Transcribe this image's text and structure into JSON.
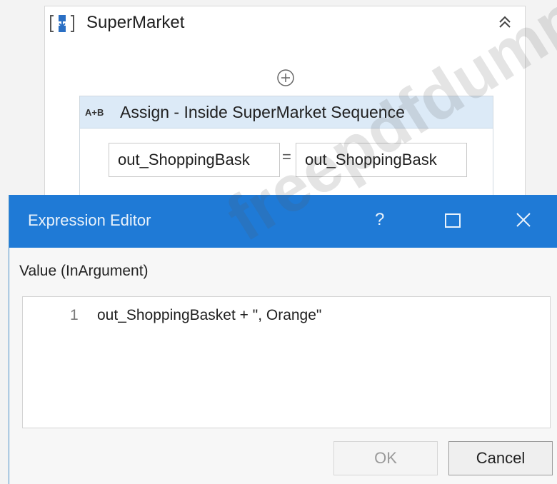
{
  "sequence": {
    "title": "SuperMarket",
    "icon": "sequence-icon",
    "collapse_icon": "double-chevron-up-icon",
    "add_icon": "plus-circle-icon"
  },
  "assign": {
    "icon_text": "A+B",
    "title": "Assign - Inside SuperMarket Sequence",
    "to_value": "out_ShoppingBask",
    "equals": "=",
    "value": "out_ShoppingBask"
  },
  "dialog": {
    "title": "Expression Editor",
    "help_label": "?",
    "value_label": "Value (InArgument)",
    "line_number": "1",
    "code": "out_ShoppingBasket + \", Orange\"",
    "ok_label": "OK",
    "cancel_label": "Cancel",
    "title_bar_color": "#1f7ad6"
  },
  "watermark": "freepdfdumps"
}
